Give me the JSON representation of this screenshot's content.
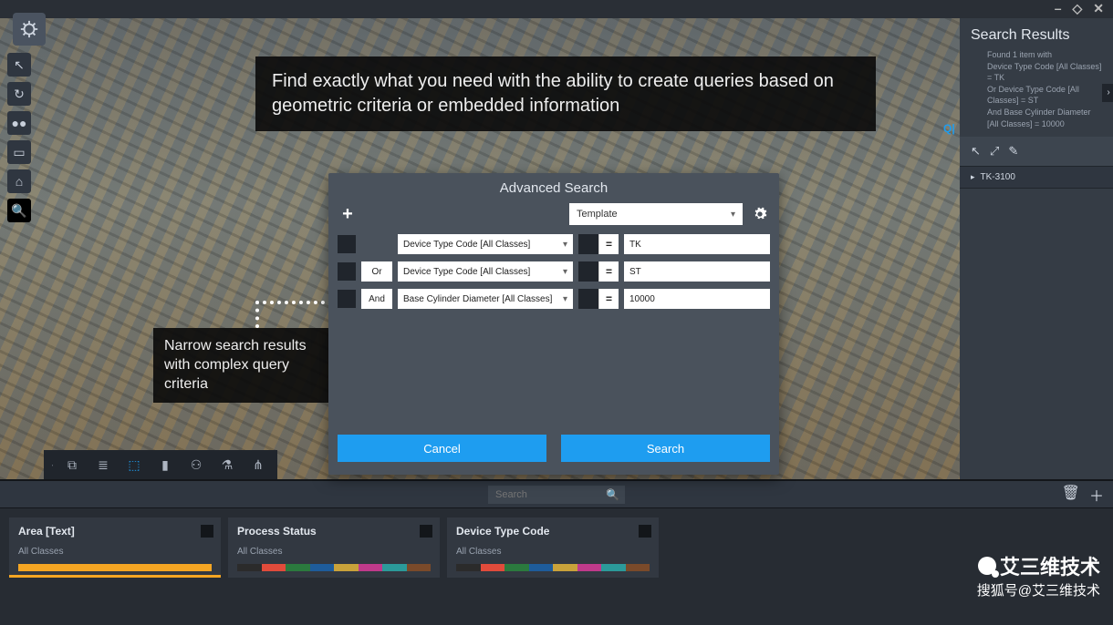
{
  "window_controls": {
    "min": "–",
    "mid": "◇",
    "close": "✕"
  },
  "left_toolbar": [
    {
      "name": "pointer-icon",
      "glyph": "↖"
    },
    {
      "name": "orbit-icon",
      "glyph": "↻"
    },
    {
      "name": "walk-icon",
      "glyph": "●●"
    },
    {
      "name": "measure-icon",
      "glyph": "▭"
    },
    {
      "name": "home-icon",
      "glyph": "⌂"
    },
    {
      "name": "search-icon",
      "glyph": "🔍",
      "active": true
    }
  ],
  "annotation_top": "Find exactly what you need with the ability to create queries based on geometric criteria or embedded information",
  "annotation_left": "Narrow search results with complex query criteria",
  "dialog": {
    "title": "Advanced Search",
    "template_label": "Template",
    "rows": [
      {
        "logic": "",
        "field": "Device Type Code [All Classes]",
        "op": "=",
        "value": "TK"
      },
      {
        "logic": "Or",
        "field": "Device Type Code [All Classes]",
        "op": "=",
        "value": "ST"
      },
      {
        "logic": "And",
        "field": "Base Cylinder Diameter [All Classes]",
        "op": "=",
        "value": "10000"
      }
    ],
    "cancel": "Cancel",
    "search": "Search"
  },
  "right_panel": {
    "title": "Search Results",
    "desc_line1": "Found 1 item with",
    "desc_line2": "Device Type Code [All Classes] = TK",
    "desc_line3": "Or Device Type Code [All Classes] = ST",
    "desc_line4": "And Base Cylinder Diameter [All Classes] = 10000",
    "item": "TK-3100"
  },
  "bottom_toolbar": [
    {
      "name": "history-icon",
      "glyph": "⧉"
    },
    {
      "name": "layers-icon",
      "glyph": "≣"
    },
    {
      "name": "model-icon",
      "glyph": "⬚",
      "active": true
    },
    {
      "name": "tag-icon",
      "glyph": "▮"
    },
    {
      "name": "people-icon",
      "glyph": "⚇"
    },
    {
      "name": "filter-icon",
      "glyph": "⚗"
    },
    {
      "name": "hierarchy-icon",
      "glyph": "⋔"
    }
  ],
  "strip": {
    "search_placeholder": "Search",
    "cards": [
      {
        "title": "Area [Text]",
        "sub": "All Classes",
        "colors": [
          "#f5a623"
        ]
      },
      {
        "title": "Process Status",
        "sub": "All Classes",
        "colors": [
          "#2b2b2b",
          "#e14b3b",
          "#2b7a3e",
          "#1e5c9b",
          "#c9a23a",
          "#c03a8b",
          "#2b9a9a",
          "#7a4a2a"
        ]
      },
      {
        "title": "Device Type Code",
        "sub": "All Classes",
        "colors": [
          "#2b2b2b",
          "#e14b3b",
          "#2b7a3e",
          "#1e5c9b",
          "#c9a23a",
          "#c03a8b",
          "#2b9a9a",
          "#7a4a2a"
        ]
      }
    ]
  },
  "watermark": {
    "line1": "艾三维技术",
    "line2": "搜狐号@艾三维技术"
  }
}
